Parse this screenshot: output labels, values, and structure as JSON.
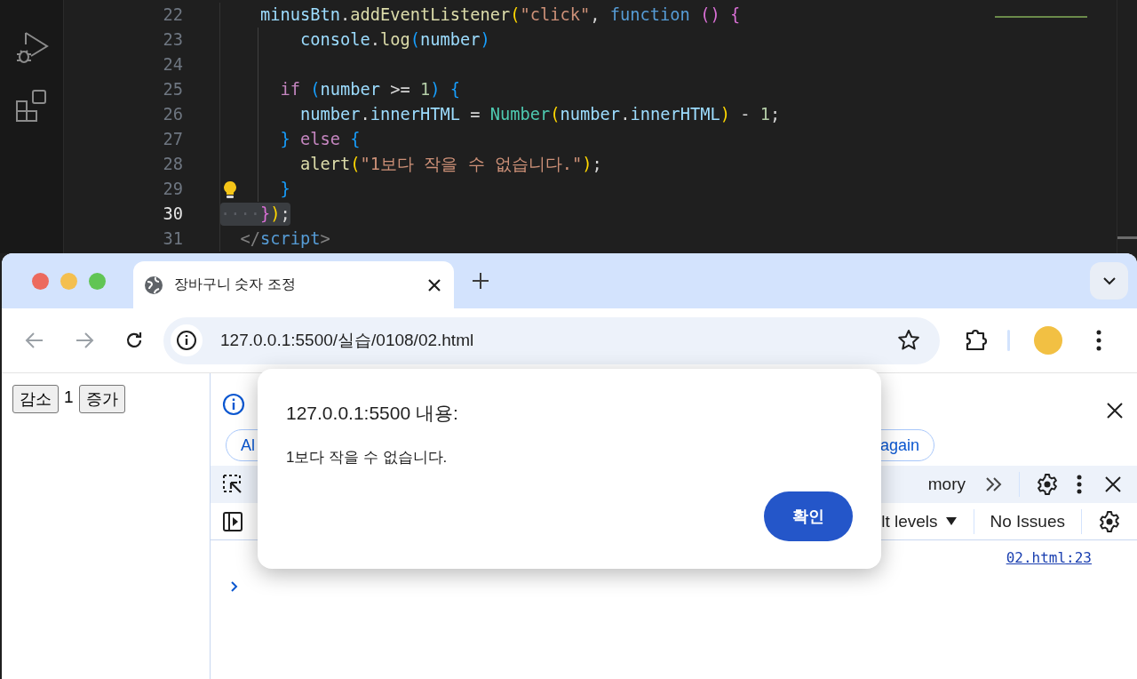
{
  "editor": {
    "lines": [
      {
        "number": "22",
        "current": false,
        "tokens": [
          {
            "kind": "var",
            "text": "    minusBtn"
          },
          {
            "kind": "plain",
            "text": "."
          },
          {
            "kind": "fn",
            "text": "addEventListener"
          },
          {
            "kind": "br1",
            "text": "("
          },
          {
            "kind": "str",
            "text": "\"click\""
          },
          {
            "kind": "plain",
            "text": ","
          },
          {
            "kind": "kw",
            "text": " function "
          },
          {
            "kind": "br2",
            "text": "() {"
          }
        ]
      },
      {
        "number": "23",
        "current": false,
        "tokens": [
          {
            "kind": "var",
            "text": "        console"
          },
          {
            "kind": "plain",
            "text": "."
          },
          {
            "kind": "fn",
            "text": "log"
          },
          {
            "kind": "br3",
            "text": "("
          },
          {
            "kind": "var",
            "text": "number"
          },
          {
            "kind": "br3",
            "text": ")"
          }
        ]
      },
      {
        "number": "24",
        "current": false
      },
      {
        "number": "25",
        "current": false,
        "tokens": [
          {
            "kind": "ctrl",
            "text": "      if "
          },
          {
            "kind": "br3",
            "text": "("
          },
          {
            "kind": "var",
            "text": "number"
          },
          {
            "kind": "plain",
            "text": " >= "
          },
          {
            "kind": "num",
            "text": "1"
          },
          {
            "kind": "br3",
            "text": ") {"
          }
        ]
      },
      {
        "number": "26",
        "current": false,
        "tokens": [
          {
            "kind": "var",
            "text": "        number"
          },
          {
            "kind": "plain",
            "text": "."
          },
          {
            "kind": "var",
            "text": "innerHTML"
          },
          {
            "kind": "plain",
            "text": " = "
          },
          {
            "kind": "class",
            "text": "Number"
          },
          {
            "kind": "br1",
            "text": "("
          },
          {
            "kind": "var",
            "text": "number"
          },
          {
            "kind": "plain",
            "text": "."
          },
          {
            "kind": "var",
            "text": "innerHTML"
          },
          {
            "kind": "br1",
            "text": ")"
          },
          {
            "kind": "plain",
            "text": " - "
          },
          {
            "kind": "num",
            "text": "1"
          },
          {
            "kind": "plain",
            "text": ";"
          }
        ]
      },
      {
        "number": "27",
        "current": false,
        "tokens": [
          {
            "kind": "br3",
            "text": "      } "
          },
          {
            "kind": "ctrl",
            "text": "else"
          },
          {
            "kind": "br3",
            "text": " {"
          }
        ]
      },
      {
        "number": "28",
        "current": false,
        "tokens": [
          {
            "kind": "fn",
            "text": "        alert"
          },
          {
            "kind": "br1",
            "text": "("
          },
          {
            "kind": "str",
            "text": "\"1보다 작을 수 없습니다.\""
          },
          {
            "kind": "br1",
            "text": ")"
          },
          {
            "kind": "plain",
            "text": ";"
          }
        ]
      },
      {
        "number": "29",
        "current": false,
        "lightbulb": true,
        "tokens": [
          {
            "kind": "br3",
            "text": "      }"
          }
        ]
      },
      {
        "number": "30",
        "current": true,
        "highlighted": true,
        "tokens": [
          {
            "kind": "ws",
            "text": "····"
          },
          {
            "kind": "br2",
            "text": "}"
          },
          {
            "kind": "br1",
            "text": ")"
          },
          {
            "kind": "plain",
            "text": ";"
          }
        ]
      },
      {
        "number": "31",
        "current": false,
        "tokens": [
          {
            "kind": "tagp",
            "text": "  </"
          },
          {
            "kind": "tag",
            "text": "script"
          },
          {
            "kind": "tagp",
            "text": ">"
          }
        ]
      }
    ]
  },
  "browser": {
    "tabs": [
      {
        "title": "장바구니 숫자 조정",
        "selected": true
      }
    ],
    "back": {
      "disabled": true
    },
    "forward": {
      "disabled": true
    },
    "url": "127.0.0.1:5500/실습/0108/02.html"
  },
  "page": {
    "items": [
      {
        "kind": "button",
        "label": "감소"
      },
      {
        "kind": "text",
        "label": "1"
      },
      {
        "kind": "button",
        "label": "증가"
      }
    ]
  },
  "devtools": {
    "chips": [
      {
        "label": "Al"
      },
      {
        "label": "again"
      }
    ],
    "panel_tab": "mory",
    "levels": "lt levels",
    "issues": "No Issues",
    "source_link": "02.html:23"
  },
  "dialog": {
    "title": "127.0.0.1:5500 내용:",
    "message": "1보다 작을 수 없습니다.",
    "button": "확인"
  }
}
